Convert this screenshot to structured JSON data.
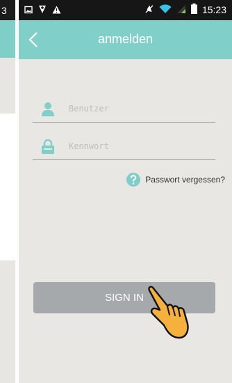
{
  "left_panel": {
    "status_digit": "3"
  },
  "status_bar": {
    "left_icons": [
      "image-notification-icon",
      "location-icon",
      "warning-icon"
    ],
    "right_icons": [
      "mute-icon",
      "wifi-icon",
      "signal-icon",
      "battery-icon"
    ],
    "time": "15:23"
  },
  "header": {
    "title": "anmelden",
    "back_icon": "chevron-left-icon"
  },
  "form": {
    "username_placeholder": "Benutzer",
    "password_placeholder": "Kennwort",
    "forgot_label": "Passwort vergessen?"
  },
  "button": {
    "sign_in": "SIGN IN"
  },
  "colors": {
    "header": "#80cfc9",
    "background": "#e9e7e4",
    "icon": "#7fcfc8",
    "button": "#a6a9ab",
    "status_bar": "#161616",
    "cursor_hand": "#f5b13c"
  }
}
